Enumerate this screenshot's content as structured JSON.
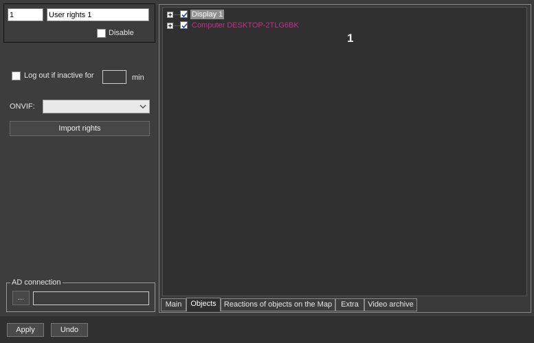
{
  "user": {
    "id_value": "1",
    "name_value": "User rights 1",
    "disable_label": "Disable",
    "disable_checked": false
  },
  "inactive": {
    "label": "Log out if inactive for",
    "value": "",
    "unit": "min",
    "checked": false
  },
  "onvif": {
    "label": "ONVIF:",
    "selected": ""
  },
  "import_rights_label": "Import rights",
  "ad_connection": {
    "legend": "AD connection",
    "browse_label": "...",
    "value": ""
  },
  "tree": {
    "items": [
      {
        "label": "Display 1",
        "checked": true,
        "selected": true
      },
      {
        "label": "Computer DESKTOP-2TLG6BK",
        "checked": true,
        "selected": false
      }
    ],
    "overlay_number": "1"
  },
  "tabs": [
    {
      "label": "Main",
      "active": false
    },
    {
      "label": "Objects",
      "active": true
    },
    {
      "label": "Reactions of objects on the Map",
      "active": false
    },
    {
      "label": "Extra",
      "active": false
    },
    {
      "label": "Video archive",
      "active": false
    }
  ],
  "footer": {
    "apply_label": "Apply",
    "undo_label": "Undo"
  },
  "colors": {
    "background": "#3b3b3b",
    "computer_label": "#c2308f",
    "selection": "#8f8f8f"
  }
}
